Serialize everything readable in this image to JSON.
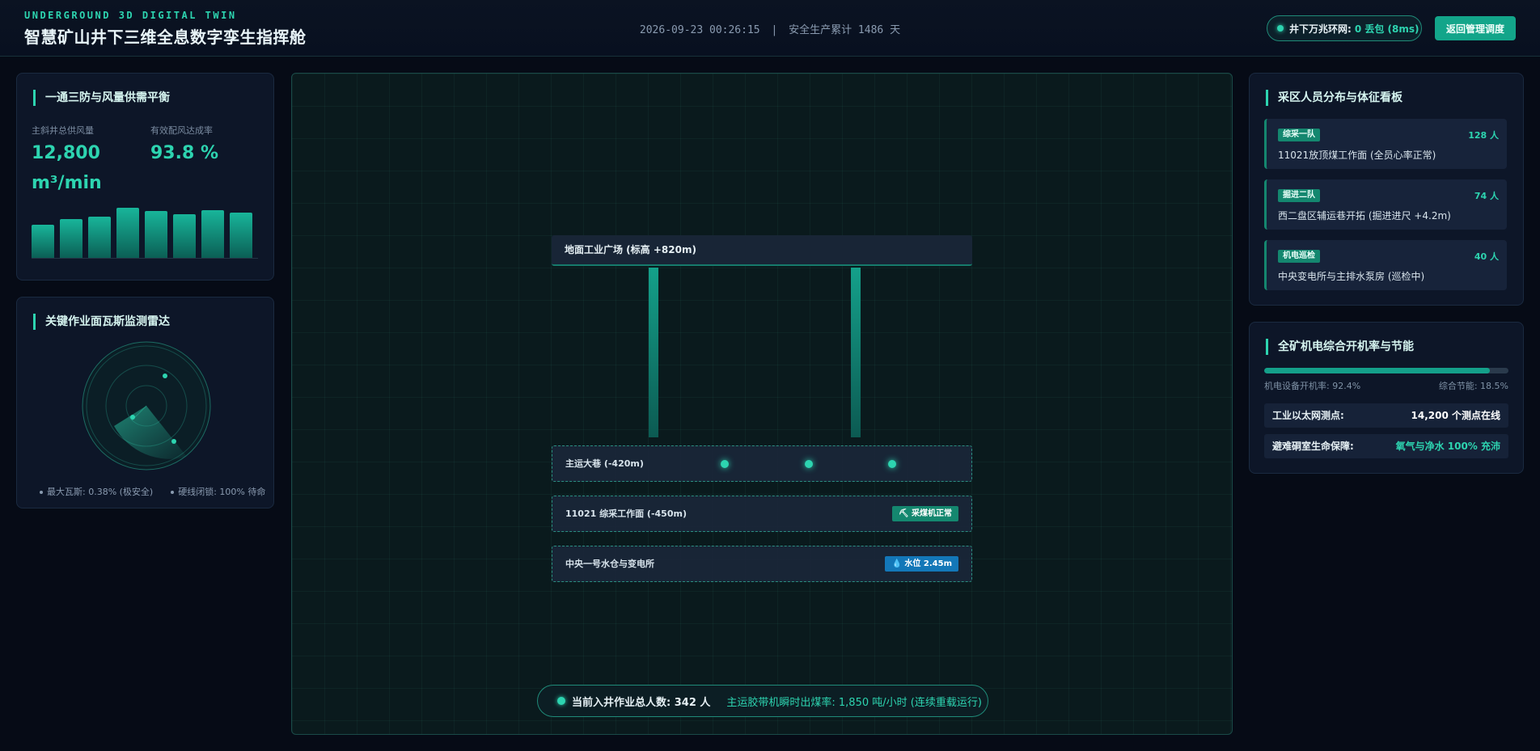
{
  "header": {
    "subtitle": "UNDERGROUND 3D DIGITAL TWIN",
    "title": "智慧矿山井下三维全息数字孪生指挥舱",
    "datetime": "2026-09-23 00:26:15",
    "separator": "|",
    "safety_text": "安全生产累计 1486 天",
    "network_label": "井下万兆环网:",
    "network_status": "0 丢包 (8ms)",
    "back_button": "返回管理调度"
  },
  "ventilation": {
    "title": "一通三防与风量供需平衡",
    "airflow_label": "主斜井总供风量",
    "airflow_value": "12,800 m³/min",
    "rate_label": "有效配风达成率",
    "rate_value": "93.8 %",
    "bars": [
      0.66,
      0.77,
      0.83,
      1.0,
      0.93,
      0.87,
      0.95,
      0.91
    ]
  },
  "gas_radar": {
    "title": "关键作业面瓦斯监测雷达",
    "legend_max": "最大瓦斯: 0.38% (极安全)",
    "legend_interlock": "硬线闭锁: 100% 待命"
  },
  "scene": {
    "surface_label": "地面工业广场 (标高 +820m)",
    "levels": [
      {
        "label": "主运大巷 (-420m)"
      },
      {
        "label": "11021 综采工作面 (-450m)",
        "badge": "采煤机正常"
      },
      {
        "label": "中央一号水仓与变电所",
        "badge": "水位 2.45m"
      }
    ],
    "bottom_people": "当前入井作业总人数: 342 人",
    "bottom_coal": "主运胶带机瞬时出煤率: 1,850 吨/小时 (连续重载运行)"
  },
  "personnel": {
    "title": "采区人员分布与体征看板",
    "teams": [
      {
        "tag": "综采一队",
        "count": "128 人",
        "desc": "11021放顶煤工作面 (全员心率正常)"
      },
      {
        "tag": "掘进二队",
        "count": "74 人",
        "desc": "西二盘区辅运巷开拓 (掘进进尺 +4.2m)"
      },
      {
        "tag": "机电巡检",
        "count": "40 人",
        "desc": "中央变电所与主排水泵房 (巡检中)"
      }
    ]
  },
  "equipment": {
    "title": "全矿机电综合开机率与节能",
    "progress": 0.924,
    "rate_label": "机电设备开机率: 92.4%",
    "saving_label": "综合节能: 18.5%",
    "rows": [
      {
        "key": "工业以太网测点:",
        "value": "14,200 个测点在线"
      },
      {
        "key": "避难硐室生命保障:",
        "value": "氧气与净水 100% 充沛"
      }
    ]
  },
  "colors": {
    "accent": "#2dd4b0",
    "accent_dark": "#13a58a",
    "water_badge": "#1377b8",
    "background": "#060b16"
  }
}
